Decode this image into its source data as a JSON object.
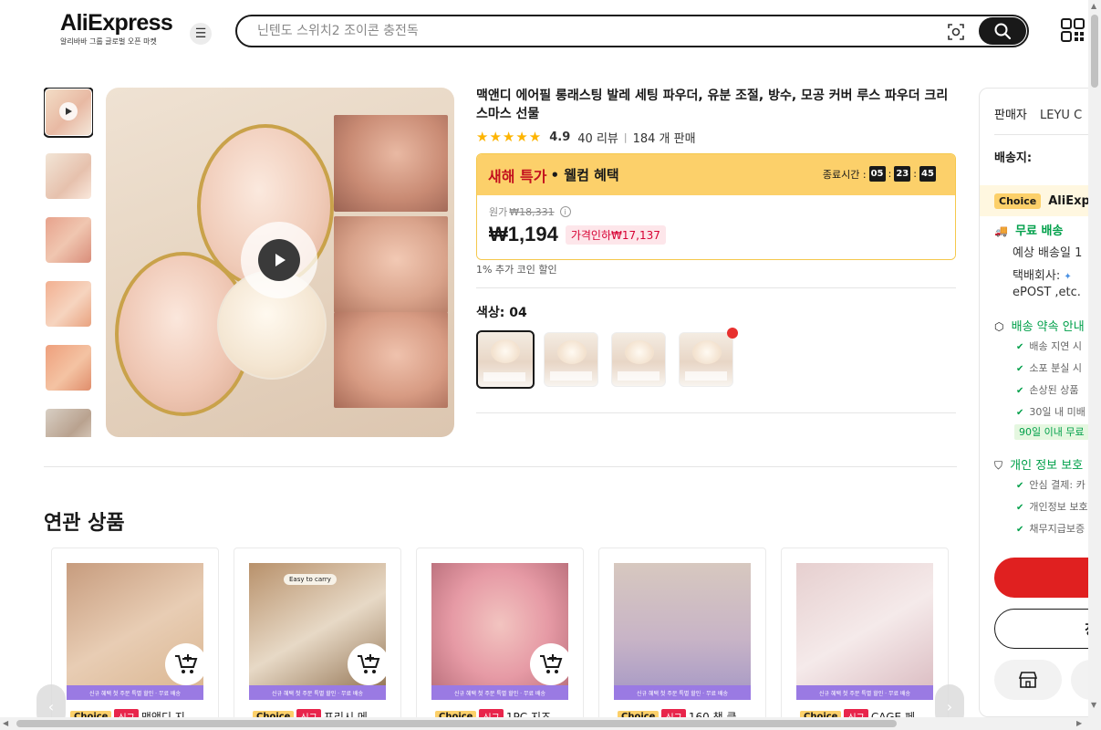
{
  "header": {
    "logo": "AliExpress",
    "logo_sub": "알리바바 그룹 글로벌 오픈 마켓",
    "search_placeholder": "닌텐도 스위치2 조이콘 충전독"
  },
  "product": {
    "title": "맥앤디 에어필 롱래스팅 발레 세팅 파우더, 유분 조절, 방수, 모공 커버 루스 파우더 크리스마스 선물",
    "rating": "4.9",
    "stars": "★★★★★",
    "reviews": "40 리뷰",
    "sold": "184 개 판매",
    "deal": {
      "title": "새해 특가",
      "subtitle": "• 웰컴 혜택",
      "timer_label": "종료시간 :",
      "timer": [
        "05",
        "23",
        "45"
      ],
      "original_label": "원가",
      "original_price": "₩18,331",
      "price": "₩1,194",
      "discount": "가격인하₩17,137"
    },
    "coin_note": "1% 추가 코인 할인",
    "color_label": "색상: 04"
  },
  "related": {
    "title": "연관 상품",
    "promo_strip": "신규 혜택 첫 주문 특별 할인 · 무료 배송",
    "tag_choice": "Choice",
    "tag_new": "신규",
    "items": [
      {
        "name": "맥앤디 지"
      },
      {
        "name": "프리시 메"
      },
      {
        "name": "1PC 지즈"
      },
      {
        "name": "160 책 클"
      },
      {
        "name": "CAGE 페"
      }
    ],
    "easy_to_carry": "Easy to carry"
  },
  "panel": {
    "seller_label": "판매자",
    "seller_name": "LEYU C",
    "ship_to": "배송지:",
    "choice_badge": "Choice",
    "choice_text": "AliExpr",
    "free_shipping": "무료 배송",
    "est_delivery": "예상 배송일 1",
    "courier": "택배회사: ",
    "courier_names": "ePOST ,etc.",
    "promise_title": "배송 약속 안내",
    "promise_items": [
      "배송 지연 시",
      "소포 분실 시",
      "손상된 상품",
      "30일 내 미배"
    ],
    "promise_pill": "90일 이내 무료",
    "privacy_title": "개인 정보 보호",
    "privacy_items": [
      "안심 결제: 카",
      "개인정보 보호",
      "채무지급보증"
    ],
    "cart_label": "장"
  }
}
